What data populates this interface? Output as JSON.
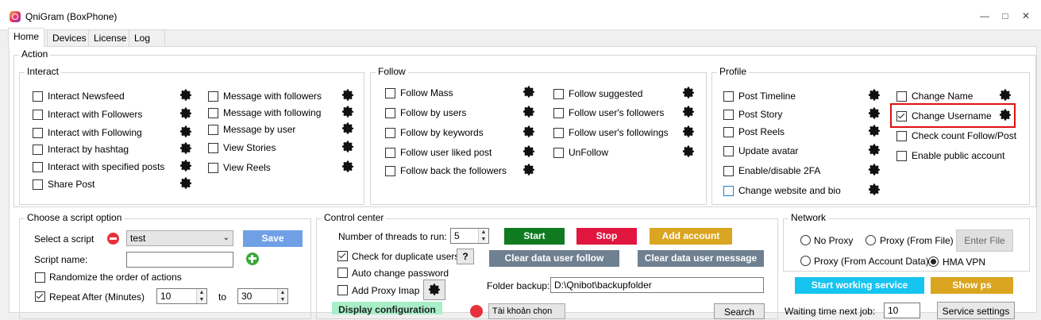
{
  "app": {
    "title": "QniGram (BoxPhone)"
  },
  "tabs": [
    "Home",
    "Devices",
    "License",
    "Log"
  ],
  "action": {
    "label": "Action"
  },
  "interact": {
    "label": "Interact",
    "col1": [
      "Interact Newsfeed",
      "Interact with Followers",
      "Interact with Following",
      "Interact by hashtag",
      "Interact with specified posts",
      "Share Post"
    ],
    "col2": [
      "Message with followers",
      "Message with following",
      "Message by user",
      "View Stories",
      "View Reels"
    ]
  },
  "follow": {
    "label": "Follow",
    "col1": [
      "Follow Mass",
      "Follow by users",
      "Follow by keywords",
      "Follow user liked post",
      "Follow back the followers"
    ],
    "col2": [
      "Follow suggested",
      "Follow user's followers",
      "Follow user's followings",
      "UnFollow"
    ]
  },
  "profile": {
    "label": "Profile",
    "col1": [
      "Post Timeline",
      "Post Story",
      "Post Reels",
      "Update avatar",
      "Enable/disable 2FA",
      "Change website and bio"
    ],
    "col2": [
      "Change Name",
      "Change Username",
      "Check count Follow/Post",
      "Enable public account"
    ],
    "checked": "Change Username"
  },
  "script": {
    "label": "Choose a script option",
    "select_label": "Select a script",
    "select_value": "test",
    "save": "Save",
    "name_label": "Script name:",
    "name_value": "",
    "randomize": "Randomize the order of actions",
    "repeat": "Repeat After (Minutes)",
    "repeat_from": "10",
    "to": "to",
    "repeat_to": "30"
  },
  "control": {
    "label": "Control center",
    "threads_label": "Number of threads to run:",
    "threads": "5",
    "check_dup": "Check for duplicate users",
    "help": "?",
    "auto_pw": "Auto change password",
    "add_proxy": "Add Proxy Imap",
    "start": "Start",
    "stop": "Stop",
    "add_account": "Add account",
    "clear_follow": "Clear data user follow",
    "clear_message": "Clear data user message",
    "folder_label": "Folder backup:",
    "folder_value": "D:\\Qnibot\\backupfolder",
    "display_config": "Display configuration",
    "tk_select": "Tài khoản chọn",
    "search": "Search"
  },
  "network": {
    "label": "Network",
    "no_proxy": "No Proxy",
    "proxy_file": "Proxy (From File)",
    "enter_file": "Enter File",
    "proxy_account": "Proxy (From Account Data)",
    "hma": "HMA VPN",
    "start_service": "Start working service",
    "show_ps": "Show ps",
    "waiting": "Waiting time next job:",
    "waiting_value": "10",
    "service_settings": "Service settings"
  },
  "colors": {
    "start": "#0f7a1f",
    "stop": "#e0163f",
    "add_account": "#daa520",
    "clear": "#6f8090",
    "service": "#16c4f0",
    "show_ps": "#daa520",
    "save": "#6fa0e6",
    "highlight": "#e01010"
  }
}
